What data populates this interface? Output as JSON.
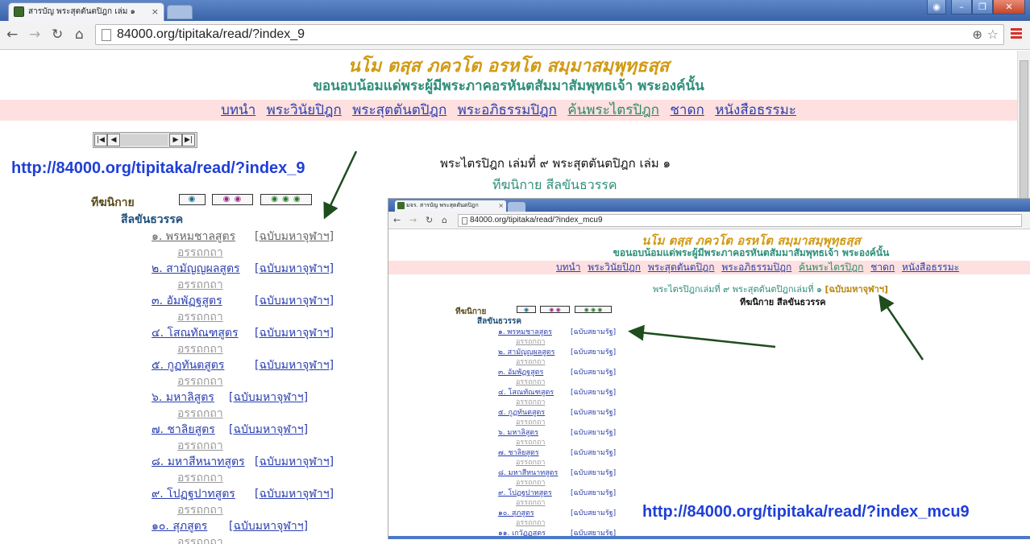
{
  "browser": {
    "tab_title": "สารบัญ พระสุตตันตปิฎก เล่ม ๑",
    "address": "84000.org/tipitaka/read/?index_9"
  },
  "site": {
    "salutation": "นโม ตสฺส ภควโต อรหโต สมฺมาสมฺพุทฺธสฺส",
    "salutation_translation": "ขอนอบน้อมแด่พระผู้มีพระภาคอรหันตสัมมาสัมพุทธเจ้า พระองค์นั้น",
    "menu": [
      "บทนำ",
      "พระวินัยปิฎก",
      "พระสุตตันตปิฎก",
      "พระอภิธรรมปิฎก",
      "ค้นพระไตรปิฎก",
      "ชาดก",
      "หนังสือธรรมะ"
    ]
  },
  "annotations": {
    "url_left": "http://84000.org/tipitaka/read/?index_9",
    "url_right": "http://84000.org/tipitaka/read/?index_mcu9"
  },
  "content": {
    "breadcrumb": "พระไตรปิฎก เล่มที่ ๙ พระสุตตันตปิฎก เล่ม ๑",
    "subheading": "ทีฆนิกาย สีลขันธวรรค",
    "nikaya_label": "ทีฆนิกาย",
    "vagga_label": "สีลขันธวรรค",
    "atthakatha_label": "อรรถกถา",
    "edition_label": "[ฉบับมหาจุฬาฯ]",
    "suttas": [
      "๑. พรหมชาลสูตร",
      "๒. สามัญญผลสูตร",
      "๓. อัมพัฏฐสูตร",
      "๔. โสณทัณฑสูตร",
      "๕. กูฏทันตสูตร",
      "๖. มหาลิสูตร",
      "๗. ชาลิยสูตร",
      "๘. มหาสีหนาทสูตร",
      "๙. โปฏฐปาทสูตร",
      "๑๐. สุภสูตร"
    ]
  },
  "inset": {
    "tab_title": "มจร. สารบัญ พระสุตตันตปิฎก",
    "address": "84000.org/tipitaka/read/?index_mcu9",
    "breadcrumb": "พระไตรปิฎกเล่มที่ ๙ พระสุตตันตปิฎกเล่มที่ ๑",
    "breadcrumb_edition": "[ฉบับมหาจุฬาฯ]",
    "subheading": "ทีฆนิกาย สีลขันธวรรค",
    "nikaya_label": "ทีฆนิกาย",
    "vagga_label": "สีลขันธวรรค",
    "atthakatha_label": "อรรถกถา",
    "edition_label": "[ฉบับสยามรัฐ]",
    "suttas": [
      "๑. พรหมชาลสูตร",
      "๒. สามัญญผลสูตร",
      "๓. อัมพัฏฐสูตร",
      "๔. โสณทัณฑสูตร",
      "๕. กูฏทันตสูตร",
      "๖. มหาลิสูตร",
      "๗. ชาลิยสูตร",
      "๘. มหาสีหนาทสูตร",
      "๙. โปฏฐปาทสูตร",
      "๑๐. สุภสูตร",
      "๑๑. เกวัฏฏสูตร"
    ]
  },
  "colors": {
    "salutation": "#d19a14",
    "translation": "#2f8f7a",
    "link": "#2a3fae",
    "url_annotation": "#1f3fd8",
    "arrow": "#1e4d1e",
    "menu_bg": "#fde0df"
  }
}
